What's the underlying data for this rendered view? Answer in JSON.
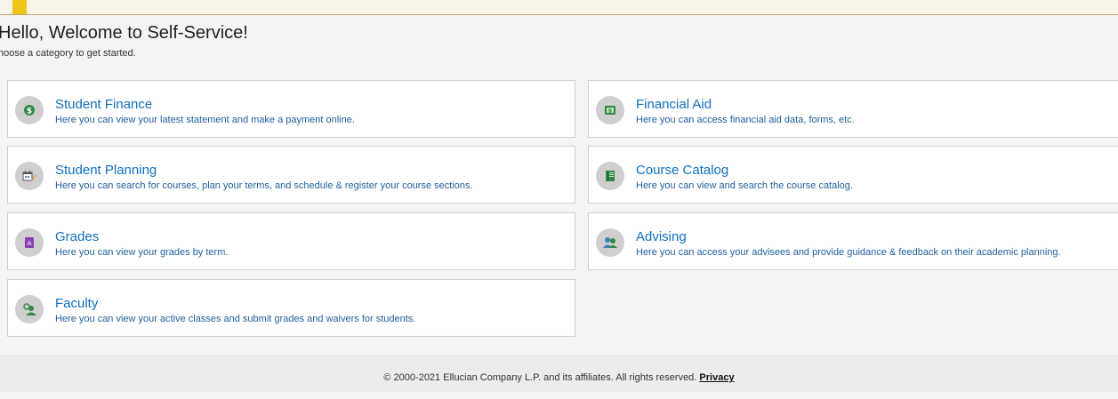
{
  "header": {
    "title": "Hello, Welcome to Self-Service!",
    "subtitle": "hoose a category to get started."
  },
  "cards": [
    {
      "title": "Student Finance",
      "description": "Here you can view your latest statement and make a payment online.",
      "icon": "dollar-coin-icon"
    },
    {
      "title": "Financial Aid",
      "description": "Here you can access financial aid data, forms, etc.",
      "icon": "money-icon"
    },
    {
      "title": "Student Planning",
      "description": "Here you can search for courses, plan your terms, and schedule & register your course sections.",
      "icon": "calendar-pencil-icon"
    },
    {
      "title": "Course Catalog",
      "description": "Here you can view and search the course catalog.",
      "icon": "book-icon"
    },
    {
      "title": "Grades",
      "description": "Here you can view your grades by term.",
      "icon": "grade-report-icon"
    },
    {
      "title": "Advising",
      "description": "Here you can access your advisees and provide guidance & feedback on their academic planning.",
      "icon": "people-icon"
    },
    {
      "title": "Faculty",
      "description": "Here you can view your active classes and submit grades and waivers for students.",
      "icon": "faculty-person-icon"
    }
  ],
  "footer": {
    "copyright": "© 2000-2021 Ellucian Company L.P. and its affiliates. All rights reserved.",
    "privacy_label": "Privacy"
  },
  "colors": {
    "link": "#0f6fbf",
    "icon_circle": "#cfcfcf",
    "accent_yellow": "#f0c419"
  }
}
